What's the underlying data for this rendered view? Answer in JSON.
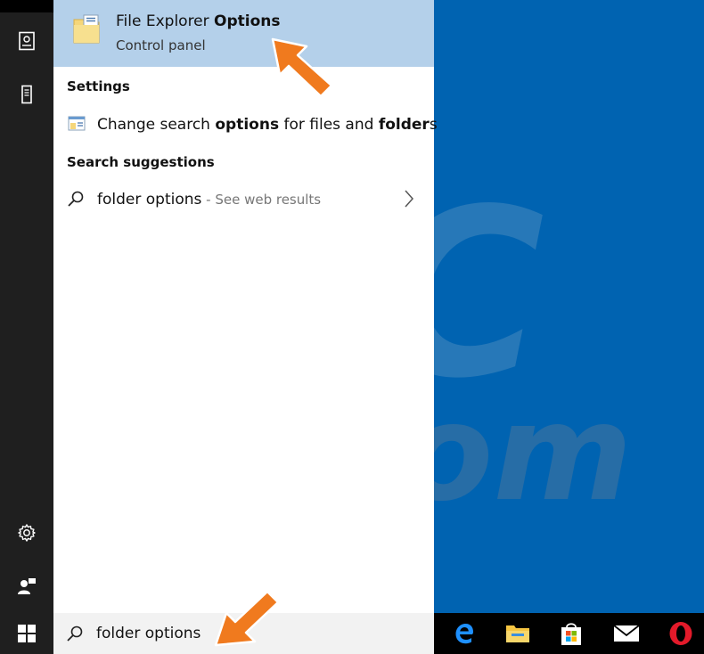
{
  "top_result": {
    "title_plain": "File Explorer ",
    "title_bold": "Options",
    "subtitle": "Control panel",
    "icon": "folder-options-icon"
  },
  "settings": {
    "heading": "Settings",
    "item": {
      "p1": "Change search ",
      "b1": "options",
      "p2": " for files and ",
      "b2": "folder",
      "p3": "s",
      "icon": "settings-window-icon"
    }
  },
  "suggestions": {
    "heading": "Search suggestions",
    "item": {
      "query": "folder options",
      "suffix": " - See web results",
      "icon": "search-icon",
      "chevron": "chevron-right-icon"
    }
  },
  "search": {
    "value": "folder options",
    "icon": "search-icon"
  },
  "watermark": {
    "line1": "PC",
    "line2": "risk.com"
  },
  "colors": {
    "desktop": "#0063b1",
    "highlight": "#b4d0ea",
    "rail": "#1f1f1f",
    "arrow": "#f07a1e",
    "taskbar": "#000000"
  }
}
